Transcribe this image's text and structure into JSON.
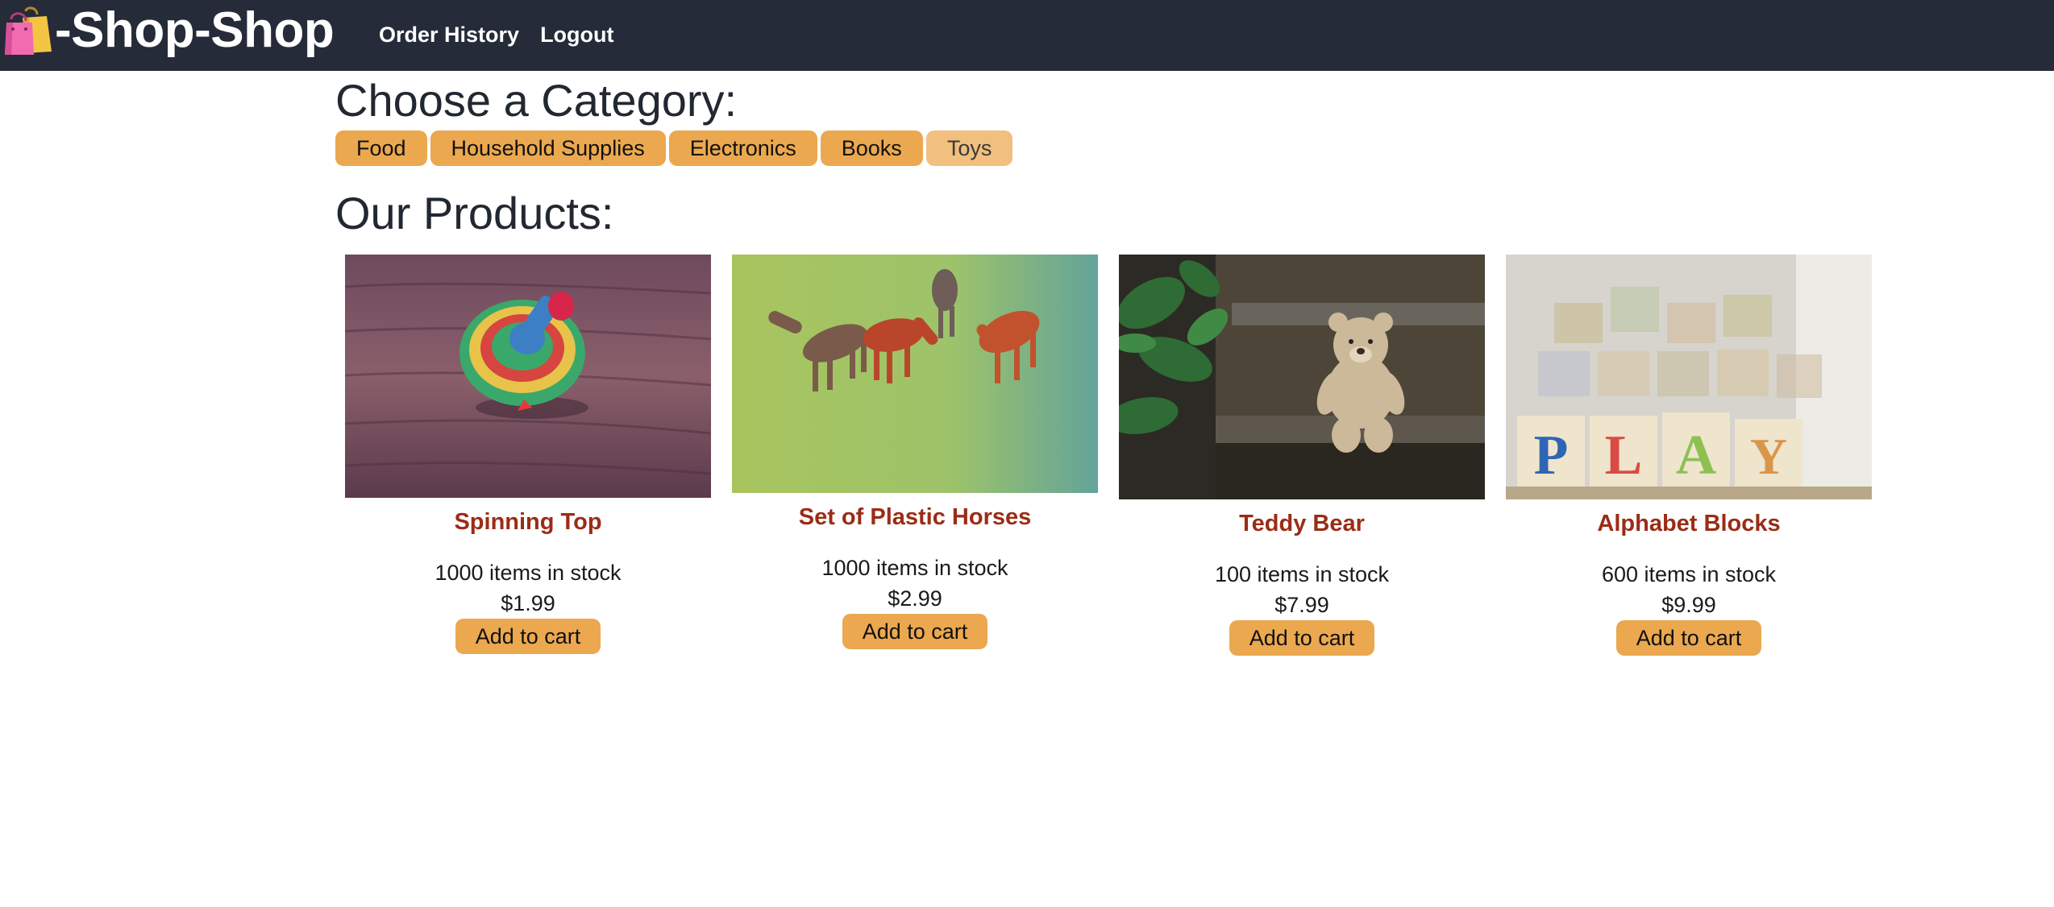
{
  "header": {
    "brand_title": "-Shop-Shop",
    "brand_icon": "shopping-bags-icon",
    "nav": {
      "order_history": "Order History",
      "logout": "Logout"
    }
  },
  "categories": {
    "title": "Choose a Category:",
    "items": [
      {
        "label": "Food"
      },
      {
        "label": "Household Supplies"
      },
      {
        "label": "Electronics"
      },
      {
        "label": "Books"
      },
      {
        "label": "Toys",
        "active": true
      }
    ]
  },
  "products": {
    "title": "Our Products:",
    "add_to_cart_label": "Add to cart",
    "items": [
      {
        "name": "Spinning Top",
        "stock": "1000 items in stock",
        "price": "$1.99",
        "image": "spinning-top-photo"
      },
      {
        "name": "Set of Plastic Horses",
        "stock": "1000 items in stock",
        "price": "$2.99",
        "image": "plastic-horses-photo"
      },
      {
        "name": "Teddy Bear",
        "stock": "100 items in stock",
        "price": "$7.99",
        "image": "teddy-bear-photo"
      },
      {
        "name": "Alphabet Blocks",
        "stock": "600 items in stock",
        "price": "$9.99",
        "image": "alphabet-blocks-photo"
      }
    ]
  },
  "colors": {
    "navbar": "#252b38",
    "button": "#eba84f",
    "button_active": "#f1bf7e",
    "product_name": "#9b2c16"
  }
}
